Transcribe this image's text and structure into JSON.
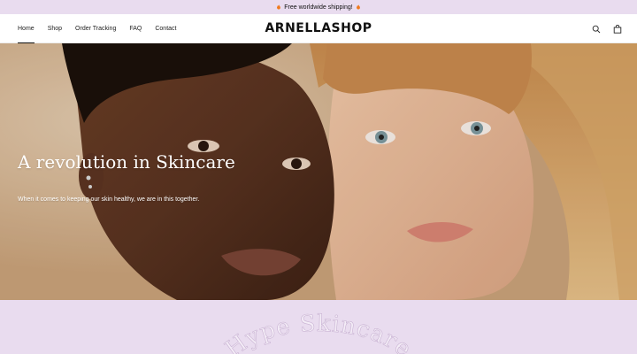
{
  "announcement": {
    "text": "Free worldwide shipping!",
    "icon_left": "fire-icon",
    "icon_right": "fire-icon"
  },
  "header": {
    "nav": [
      {
        "label": "Home",
        "active": true
      },
      {
        "label": "Shop"
      },
      {
        "label": "Order Tracking"
      },
      {
        "label": "FAQ"
      },
      {
        "label": "Contact"
      }
    ],
    "logo": "ARNELLASHOP",
    "icons": [
      "search-icon",
      "shopping-bag-icon"
    ]
  },
  "hero": {
    "title": "A revolution in Skincare",
    "subtitle": "When it comes to keeping our skin healthy, we are in this together."
  },
  "section": {
    "curved_heading": "Hype Skincare"
  },
  "colors": {
    "announcement_bg": "#e9dcef",
    "section_bg": "#e9dcef",
    "hero_text": "#ffffff",
    "curved_text": "#f4edf7"
  }
}
